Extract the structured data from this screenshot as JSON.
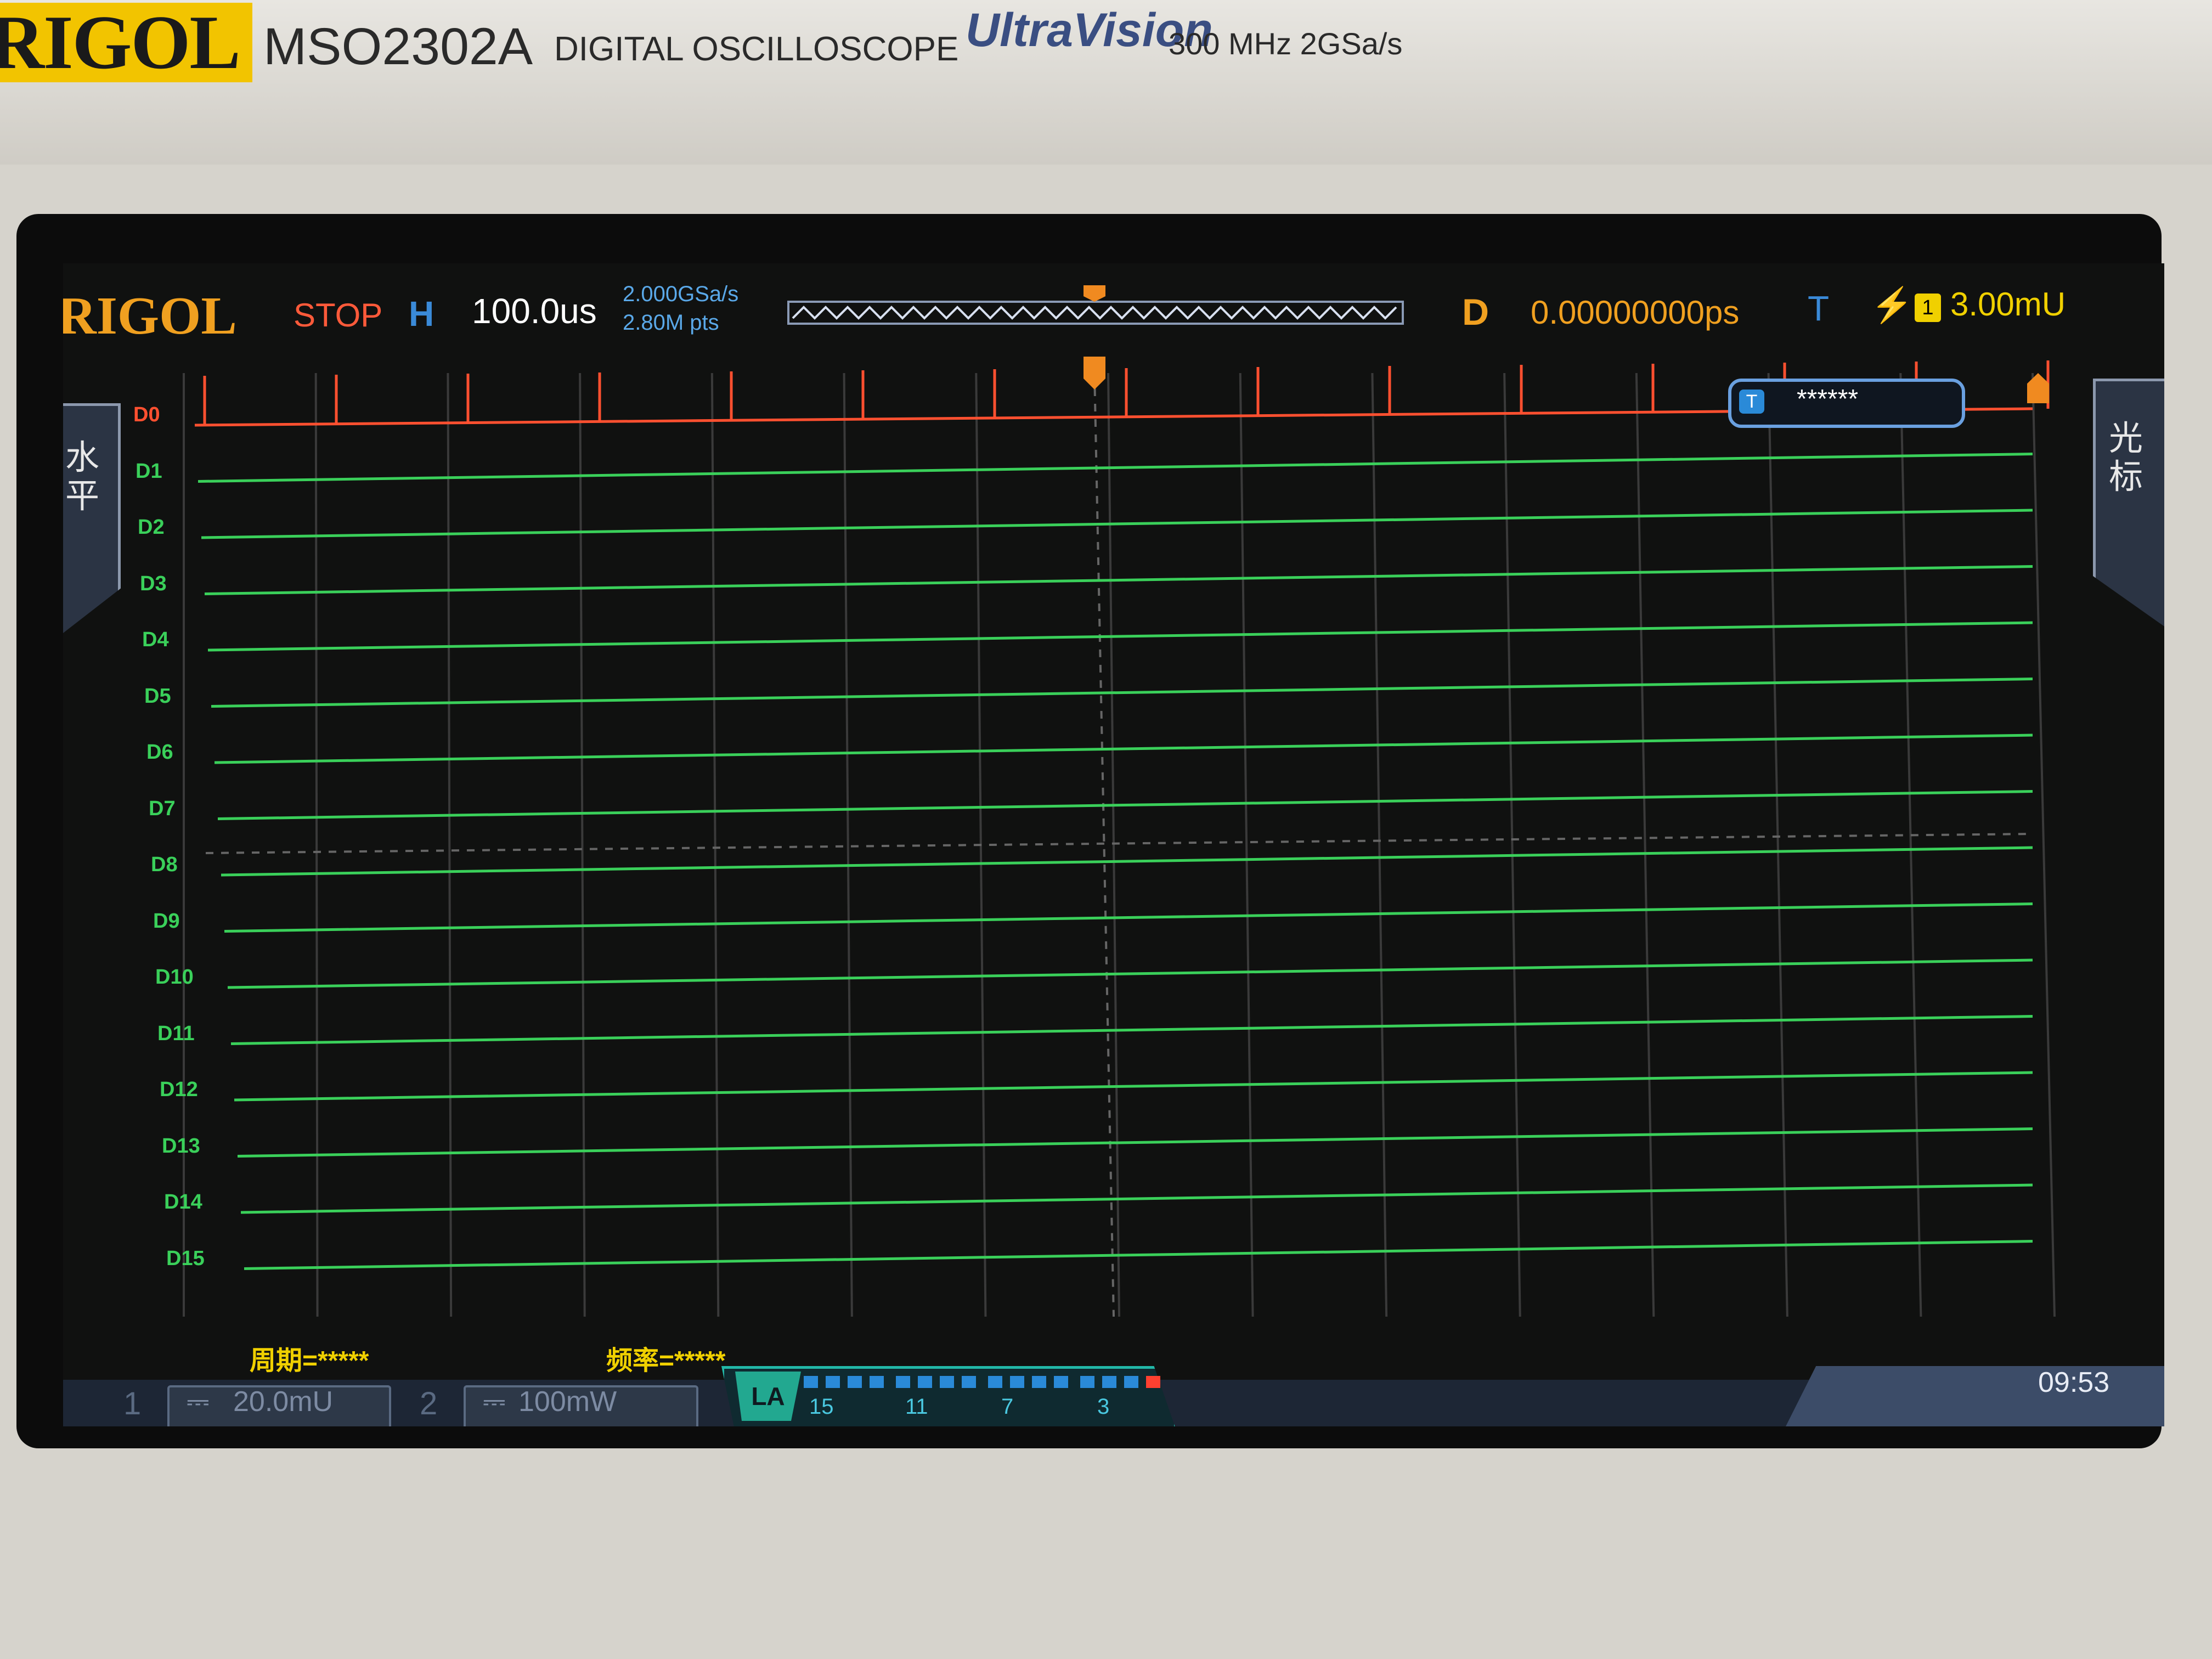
{
  "device": {
    "brand": "RIGOL",
    "model": "MSO2302A",
    "description": "DIGITAL OSCILLOSCOPE",
    "series": "UltraVision",
    "spec": "300 MHz  2GSa/s"
  },
  "status_bar": {
    "logo": "RIGOL",
    "run_state": "STOP",
    "horizontal_label": "H",
    "timebase": "100.0us",
    "sample_rate": "2.000GSa/s",
    "memory_depth": "2.80M pts",
    "delay_label": "D",
    "delay_value": "0.00000000ps",
    "trigger_label": "T",
    "trigger_source": "1",
    "trigger_level": "3.00mU"
  },
  "side_menu": {
    "left_tab": "水平",
    "right_tab": "光标"
  },
  "cursor_readout": {
    "icon": "T",
    "value": "******"
  },
  "digital_channels": [
    "D0",
    "D1",
    "D2",
    "D3",
    "D4",
    "D5",
    "D6",
    "D7",
    "D8",
    "D9",
    "D10",
    "D11",
    "D12",
    "D13",
    "D14",
    "D15"
  ],
  "measurements": {
    "period": "周期=*****",
    "frequency": "频率=*****"
  },
  "bottom_bar": {
    "ch1_num": "1",
    "ch1_scale": "20.0mU",
    "ch2_num": "2",
    "ch2_scale": "100mW",
    "la_label": "LA",
    "la_bits": [
      "15",
      "11",
      "7",
      "3"
    ],
    "clock": "09:53"
  },
  "colors": {
    "d0_trace": "#ff5030",
    "digital_trace": "#3ad05a",
    "accent_orange": "#f0a020",
    "trigger_yellow": "#f0d000",
    "blue": "#3a8ad8"
  }
}
